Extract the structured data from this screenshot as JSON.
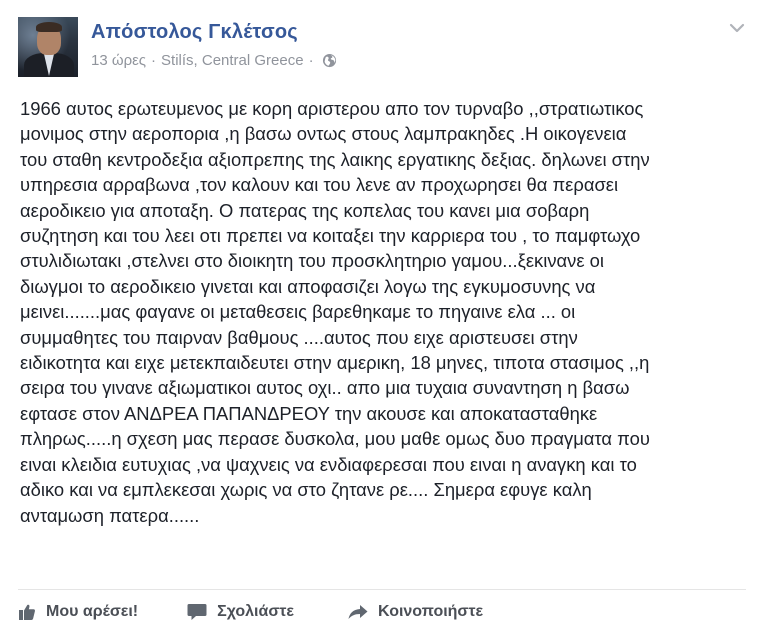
{
  "post": {
    "author": "Απόστολος Γκλέτσος",
    "time": "13 ώρες",
    "separator": "·",
    "location": "Stilís, Central Greece",
    "separator2": "·",
    "privacy_icon": "globe-icon",
    "menu_icon": "chevron-down-icon",
    "text_lines": [
      "1966 αυτος ερωτευμενος με κορη αριστερου απο τον τυρναβο ,,στρατιωτικος",
      "μονιμος στην αεροπορια ,η βασω οντως στους λαμπρακηδες .Η οικογενεια",
      "του σταθη κεντροδεξια αξιοπρεπης της λαικης εργατικης δεξιας. δηλωνει στην",
      "υπηρεσια αρραβωνα ,τον καλουν και του λενε αν προχωρησει θα περασει",
      "αεροδικειο για αποταξη. Ο πατερας της κοπελας του κανει μια σοβαρη",
      "συζητηση και του λεει οτι πρεπει να κοιταξει την καρριερα του , το παμφτωχο",
      "στυλιδιωτακι ,στελνει στο διοικητη του προσκλητηριο γαμου...ξεκινανε οι",
      "διωγμοι το αεροδικειο γινεται και αποφασιζει λογω της εγκυμοσυνης να",
      "μεινει.......μας φαγανε οι μεταθεσεις βαρεθηκαμε το πηγαινε ελα ... οι",
      "συμμαθητες του παιρναν βαθμους ....αυτος που ειχε αριστευσει στην",
      "ειδικοτητα και ειχε μετεκπαιδευτει στην αμερικη, 18 μηνες, τιποτα στασιμος ,,η",
      "σειρα του γινανε αξιωματικοι αυτος οχι.. απο μια τυχαια συναντηση η βασω",
      "εφτασε στον ΑΝΔΡΕΑ ΠΑΠΑΝΔΡΕΟΥ την ακουσε και αποκατασταθηκε",
      "πληρως.....η σχεση μας περασε δυσκολα, μου μαθε ομως δυο πραγματα που",
      "ειναι κλειδια ευτυχιας ,να ψαχνεις να ενδιαφερεσαι που ειναι η αναγκη και το",
      "αδικο και να εμπλεκεσαι χωρις να στο ζητανε ρε.... Σημερα εφυγε καλη",
      "ανταμωση πατερα......"
    ]
  },
  "actions": {
    "like_label": "Μου αρέσει!",
    "comment_label": "Σχολιάστε",
    "share_label": "Κοινοποιήστε",
    "like_icon": "thumbs-up-icon",
    "comment_icon": "comment-icon",
    "share_icon": "share-arrow-icon"
  },
  "colors": {
    "author_link": "#365899",
    "meta_text": "#90949c",
    "body_text": "#1d2129",
    "action_text": "#4b4f56",
    "divider": "#e5e5e5"
  }
}
